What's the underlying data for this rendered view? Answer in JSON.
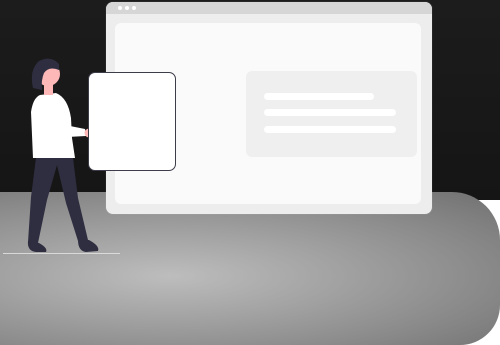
{
  "illustration": {
    "theme": "person-presenting-webpage",
    "colors": {
      "background_top": "#1c1c1c",
      "floor": "#a3a3a3",
      "browser_frame": "#ededed",
      "browser_bar": "#d6d6d6",
      "page": "#fafafa",
      "placeholder_block": "#efefef",
      "hair": "#2f2e41",
      "skin": "#ffb8b8",
      "shirt": "#ffffff",
      "pants": "#2f2e41"
    },
    "placeholder_text_lines": 3,
    "browser_window_dots": 3
  }
}
